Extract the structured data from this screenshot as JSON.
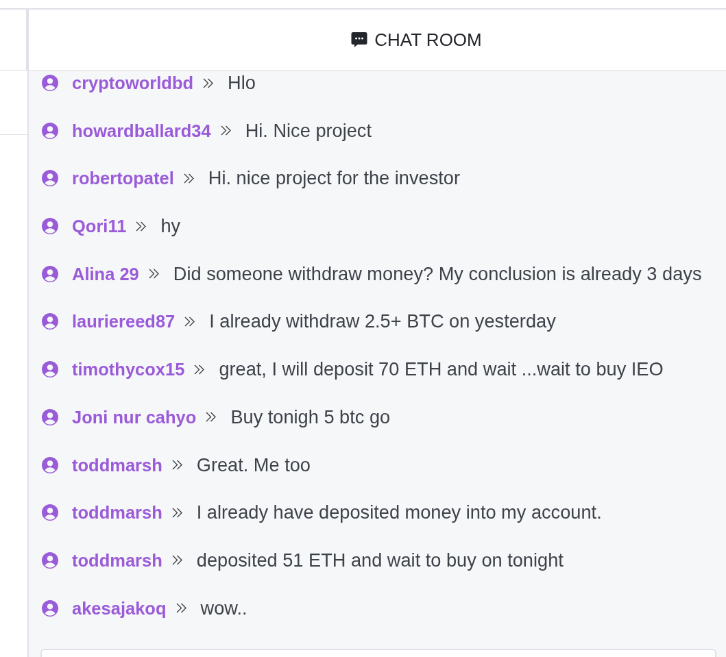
{
  "chat_room": {
    "title": "CHAT ROOM",
    "messages": [
      {
        "user": "cryptoworldbd",
        "text": "Hlo"
      },
      {
        "user": "howardballard34",
        "text": "Hi. Nice project"
      },
      {
        "user": "robertopatel",
        "text": "Hi. nice project for the investor"
      },
      {
        "user": "Qori11",
        "text": "hy"
      },
      {
        "user": "Alina 29",
        "text": "Did someone withdraw money? My conclusion is already 3 days"
      },
      {
        "user": "lauriereed87",
        "text": "I already withdraw 2.5+ BTC on yesterday"
      },
      {
        "user": "timothycox15",
        "text": "great, I will deposit 70 ETH and wait ...wait to buy IEO"
      },
      {
        "user": "Joni nur cahyo",
        "text": "Buy tonigh 5 btc go"
      },
      {
        "user": "toddmarsh",
        "text": "Great. Me too"
      },
      {
        "user": "toddmarsh",
        "text": "I already have deposited money into my account."
      },
      {
        "user": "toddmarsh",
        "text": "deposited 51 ETH and wait to buy on tonight"
      },
      {
        "user": "akesajakoq",
        "text": "wow.."
      }
    ]
  }
}
